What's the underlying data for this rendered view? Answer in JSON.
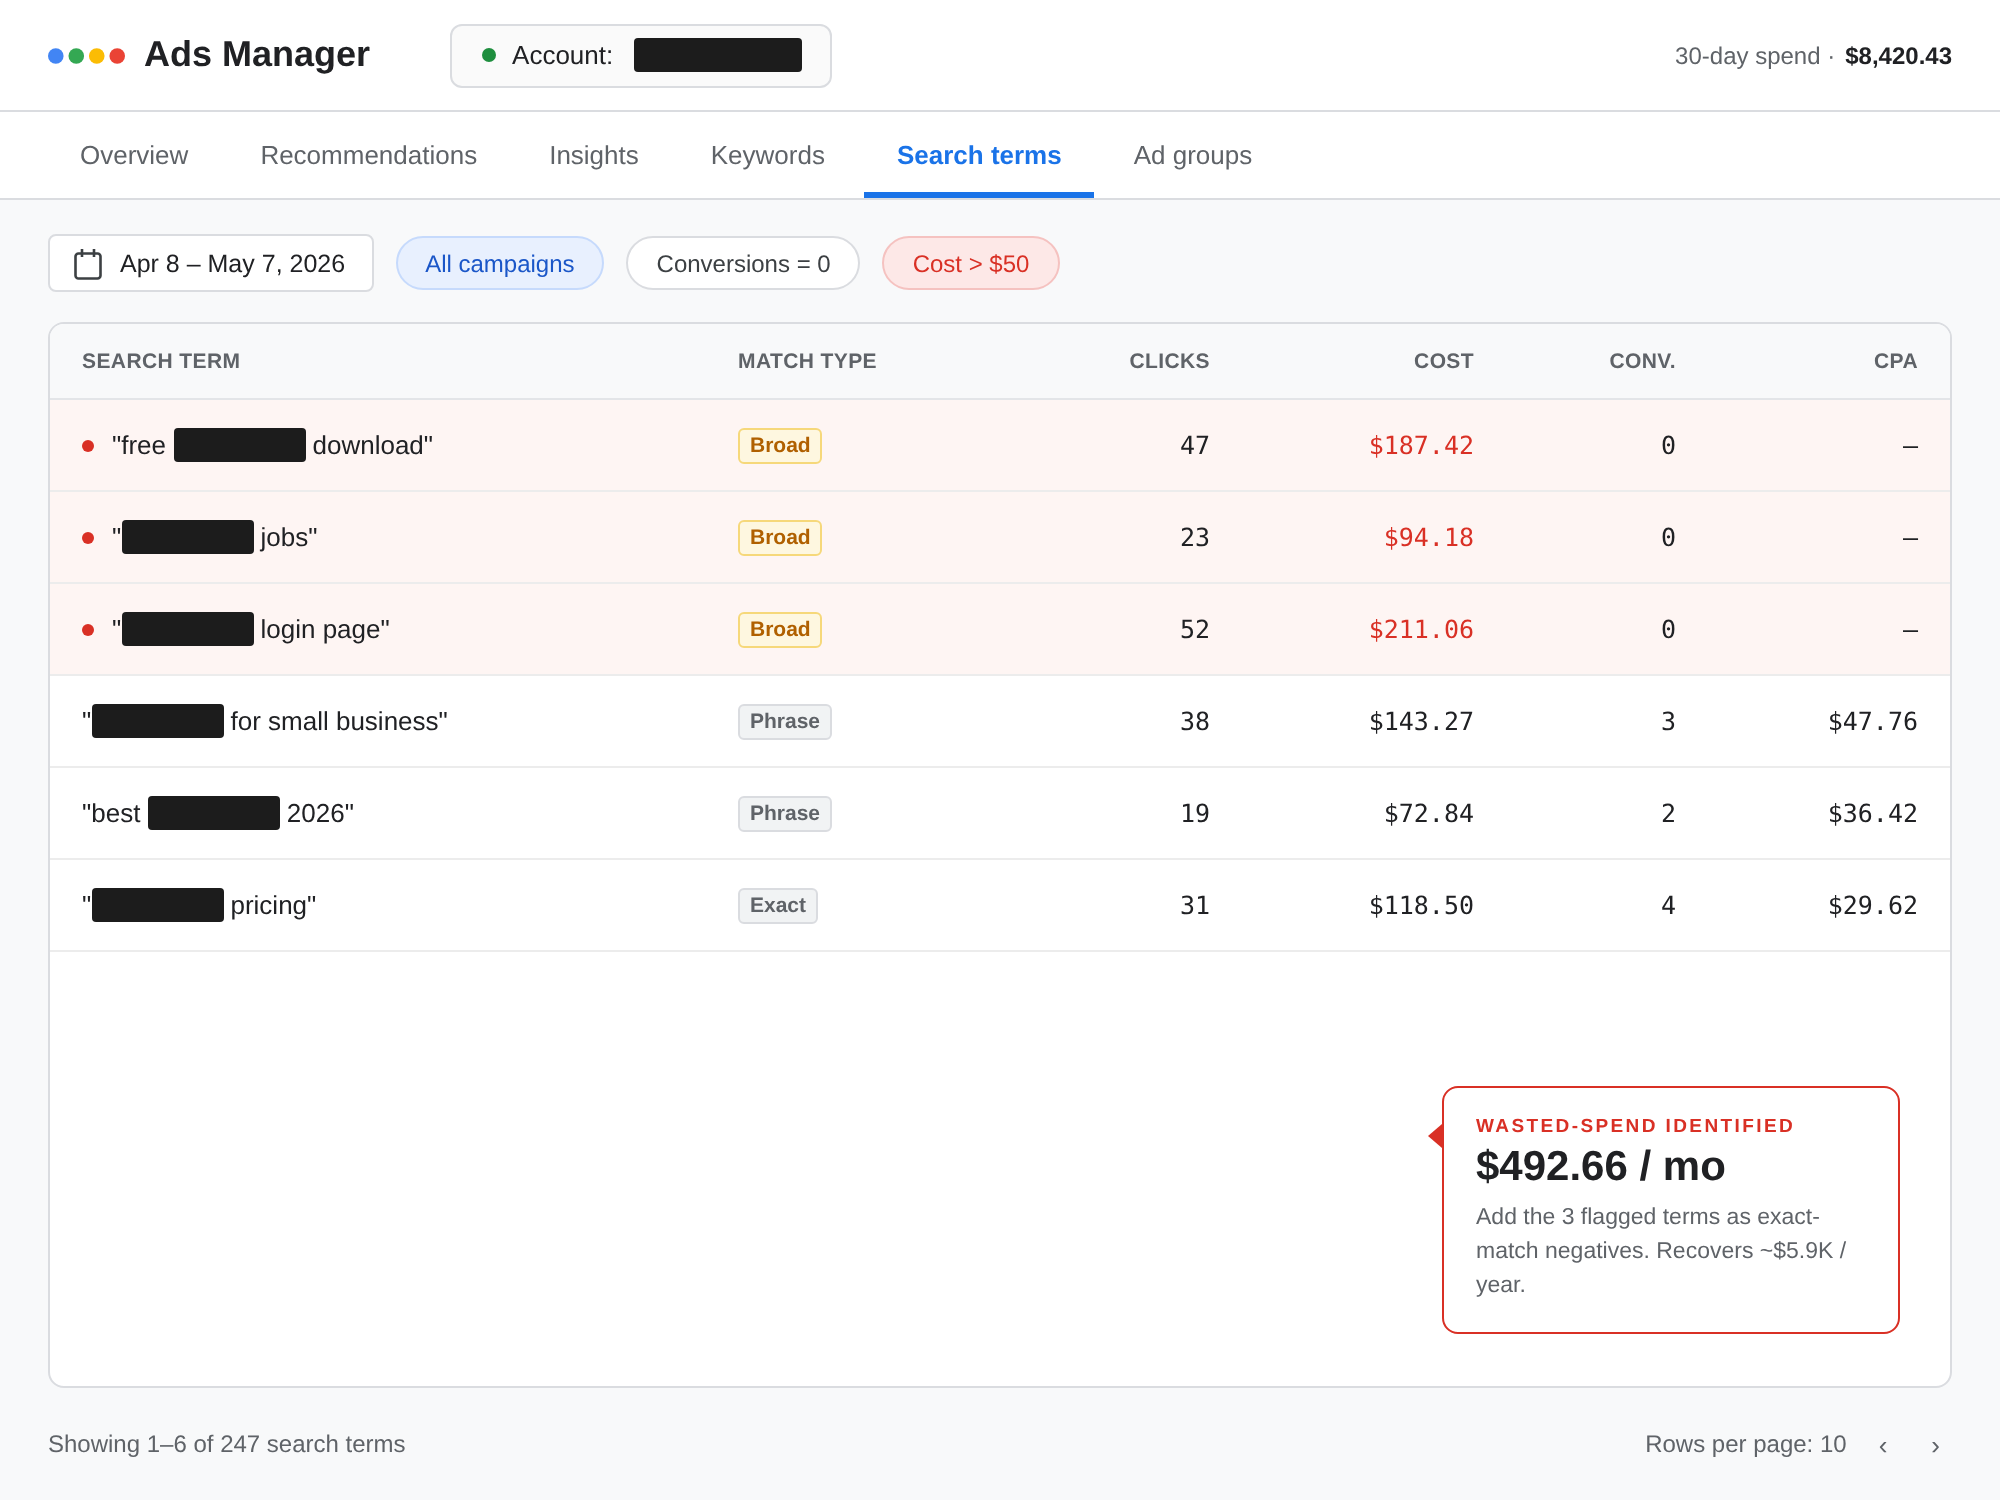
{
  "header": {
    "app_title": "Ads Manager",
    "account": {
      "label": "Account:",
      "active": true,
      "value": {
        "kind": "redacted"
      }
    },
    "spend": {
      "label": "30-day spend ·",
      "value": "$8,420.43"
    }
  },
  "tabs": [
    {
      "label": "Overview",
      "selected": false
    },
    {
      "label": "Recommendations",
      "selected": false
    },
    {
      "label": "Insights",
      "selected": false
    },
    {
      "label": "Keywords",
      "selected": false
    },
    {
      "label": "Search terms",
      "selected": true
    },
    {
      "label": "Ad groups",
      "selected": false
    }
  ],
  "filters": {
    "date_range": "Apr 8 – May 7, 2026",
    "chips": [
      {
        "label": "All campaigns",
        "kind": "primary"
      },
      {
        "label": "Conversions = 0",
        "kind": "default"
      },
      {
        "label": "Cost > $50",
        "kind": "danger"
      }
    ]
  },
  "table": {
    "columns": [
      "SEARCH TERM",
      "MATCH TYPE",
      "CLICKS",
      "COST",
      "CONV.",
      "CPA"
    ],
    "rows": [
      {
        "flagged": true,
        "term": [
          {
            "kind": "text",
            "text": "\"free "
          },
          {
            "kind": "redacted"
          },
          {
            "kind": "text",
            "text": " download\""
          }
        ],
        "match_type": {
          "label": "Broad",
          "kind": "broad"
        },
        "clicks": "47",
        "cost": "$187.42",
        "conv": "0",
        "cpa": "—"
      },
      {
        "flagged": true,
        "term": [
          {
            "kind": "text",
            "text": "\""
          },
          {
            "kind": "redacted"
          },
          {
            "kind": "text",
            "text": " jobs\""
          }
        ],
        "match_type": {
          "label": "Broad",
          "kind": "broad"
        },
        "clicks": "23",
        "cost": "$94.18",
        "conv": "0",
        "cpa": "—"
      },
      {
        "flagged": true,
        "term": [
          {
            "kind": "text",
            "text": "\""
          },
          {
            "kind": "redacted"
          },
          {
            "kind": "text",
            "text": " login page\""
          }
        ],
        "match_type": {
          "label": "Broad",
          "kind": "broad"
        },
        "clicks": "52",
        "cost": "$211.06",
        "conv": "0",
        "cpa": "—"
      },
      {
        "flagged": false,
        "term": [
          {
            "kind": "text",
            "text": "\""
          },
          {
            "kind": "redacted"
          },
          {
            "kind": "text",
            "text": " for small business\""
          }
        ],
        "match_type": {
          "label": "Phrase",
          "kind": "phrase"
        },
        "clicks": "38",
        "cost": "$143.27",
        "conv": "3",
        "cpa": "$47.76"
      },
      {
        "flagged": false,
        "term": [
          {
            "kind": "text",
            "text": "\"best "
          },
          {
            "kind": "redacted"
          },
          {
            "kind": "text",
            "text": " 2026\""
          }
        ],
        "match_type": {
          "label": "Phrase",
          "kind": "phrase"
        },
        "clicks": "19",
        "cost": "$72.84",
        "conv": "2",
        "cpa": "$36.42"
      },
      {
        "flagged": false,
        "term": [
          {
            "kind": "text",
            "text": "\""
          },
          {
            "kind": "redacted"
          },
          {
            "kind": "text",
            "text": " pricing\""
          }
        ],
        "match_type": {
          "label": "Exact",
          "kind": "exact"
        },
        "clicks": "31",
        "cost": "$118.50",
        "conv": "4",
        "cpa": "$29.62"
      }
    ]
  },
  "callout": {
    "eyebrow": "WASTED-SPEND IDENTIFIED",
    "amount": "$492.66 / mo",
    "body": "Add the 3 flagged terms as exact-match negatives. Recovers ~$5.9K / year."
  },
  "footer": {
    "summary": "Showing 1–6 of 247 search terms",
    "rows_per_page": "Rows per page: 10",
    "prev": "‹",
    "next": "›"
  }
}
